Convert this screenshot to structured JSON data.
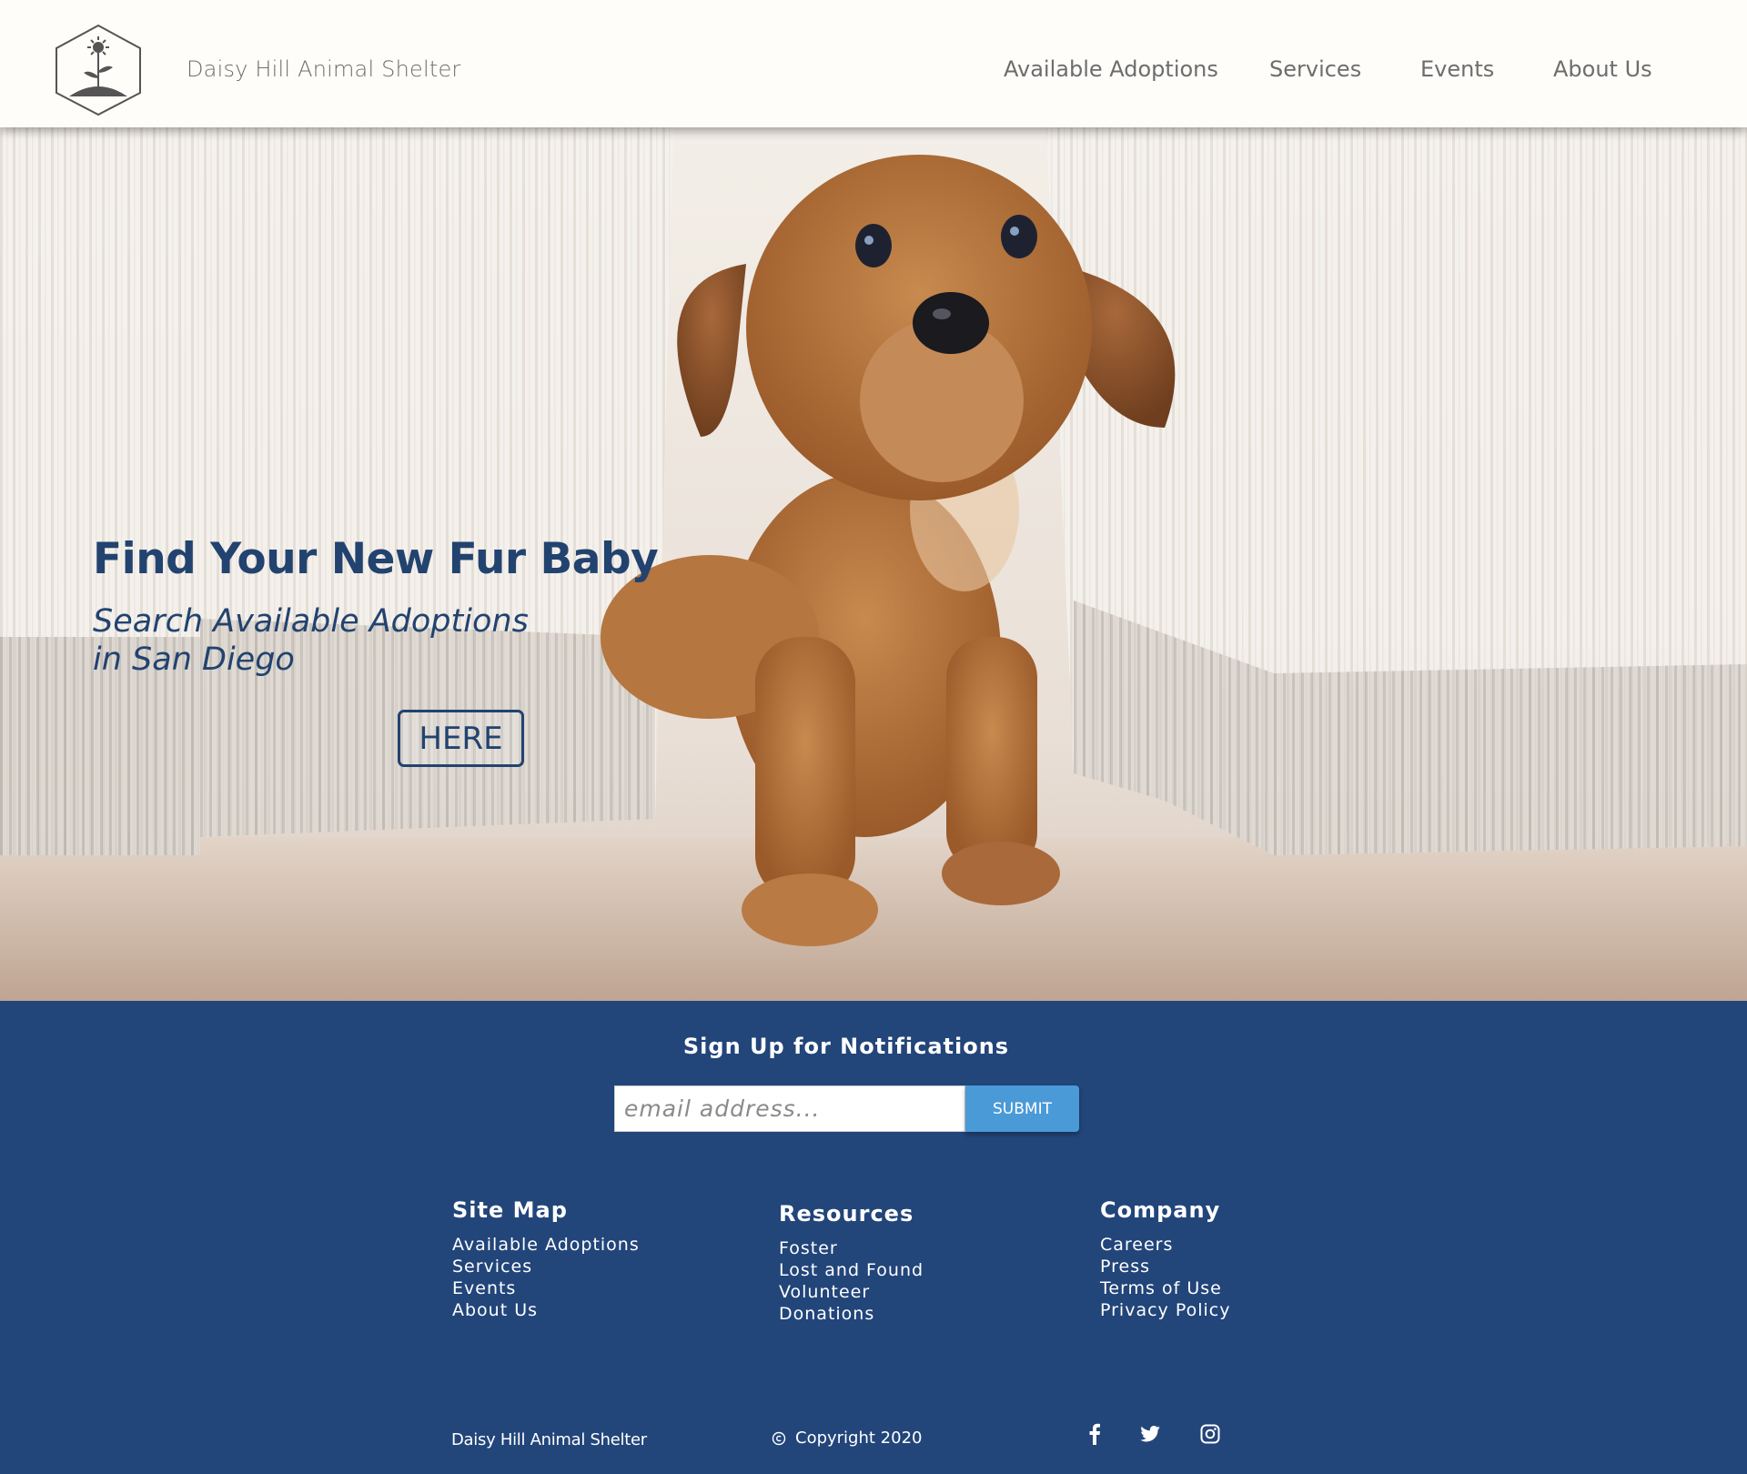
{
  "header": {
    "brand": "Daisy Hill Animal Shelter",
    "nav": [
      "Available Adoptions",
      "Services",
      "Events",
      "About Us"
    ]
  },
  "hero": {
    "title": "Find Your New Fur Baby",
    "subtitle": "Search Available Adoptions in San Diego",
    "button": "HERE"
  },
  "signup": {
    "title": "Sign Up for Notifications",
    "placeholder": "email address...",
    "submit": "SUBMIT"
  },
  "footer": {
    "site_map": {
      "title": "Site Map",
      "links": [
        "Available Adoptions",
        "Services",
        "Events",
        "About Us"
      ]
    },
    "resources": {
      "title": "Resources",
      "links": [
        "Foster",
        "Lost and Found",
        "Volunteer",
        "Donations"
      ]
    },
    "company": {
      "title": "Company",
      "links": [
        "Careers",
        "Press",
        "Terms of Use",
        "Privacy Policy"
      ]
    },
    "brand": "Daisy Hill Animal Shelter",
    "copyright": "Copyright 2020",
    "social": [
      "facebook-icon",
      "twitter-icon",
      "instagram-icon"
    ]
  },
  "colors": {
    "primary_navy": "#22457a",
    "heading_navy": "#22436f",
    "submit_blue": "#4a9ad8",
    "header_bg": "#fefdfa",
    "nav_gray": "#6d6d6d"
  }
}
